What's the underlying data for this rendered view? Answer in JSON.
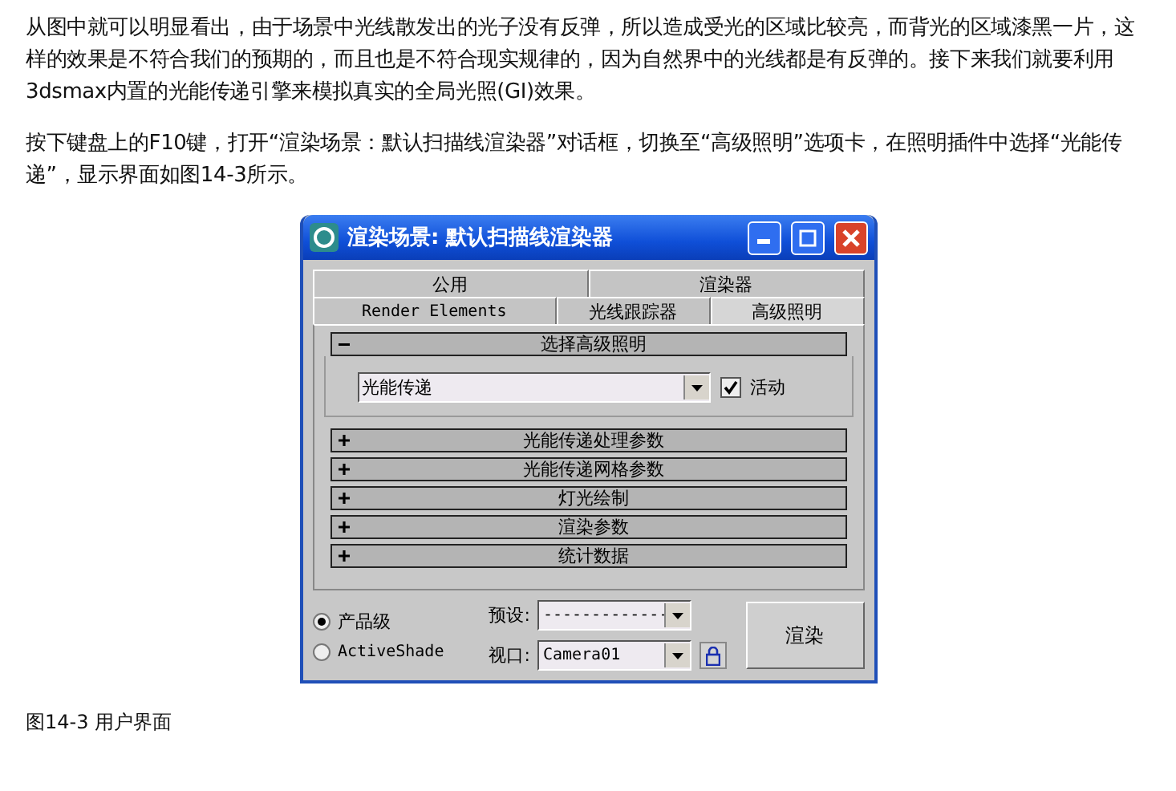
{
  "article": {
    "paragraphs": [
      "从图中就可以明显看出，由于场景中光线散发出的光子没有反弹，所以造成受光的区域比较亮，而背光的区域漆黑一片，这样的效果是不符合我们的预期的，而且也是不符合现实规律的，因为自然界中的光线都是有反弹的。接下来我们就要利用3dsmax内置的光能传递引擎来模拟真实的全局光照(GI)效果。",
      "按下键盘上的F10键，打开“渲染场景：默认扫描线渲染器”对话框，切换至“高级照明”选项卡，在照明插件中选择“光能传递”，显示界面如图14-3所示。"
    ]
  },
  "dialog": {
    "title": "渲染场景: 默认扫描线渲染器",
    "tab_rows": [
      [
        {
          "label": "公用",
          "selected": false
        },
        {
          "label": "渲染器",
          "selected": false
        }
      ],
      [
        {
          "label": "Render Elements",
          "selected": false
        },
        {
          "label": "光线跟踪器",
          "selected": false
        },
        {
          "label": "高级照明",
          "selected": true
        }
      ]
    ],
    "rollouts": [
      {
        "title": "选择高级照明",
        "expanded": true,
        "plugin": "光能传递",
        "active_label": "活动",
        "active": true
      },
      {
        "title": "光能传递处理参数",
        "expanded": false
      },
      {
        "title": "光能传递网格参数",
        "expanded": false
      },
      {
        "title": "灯光绘制",
        "expanded": false
      },
      {
        "title": "渲染参数",
        "expanded": false
      },
      {
        "title": "统计数据",
        "expanded": false
      }
    ],
    "modes": [
      {
        "label": "产品级",
        "selected": true
      },
      {
        "label": "ActiveShade",
        "selected": false
      }
    ],
    "preset": {
      "label": "预设:",
      "value": "-------------"
    },
    "viewport": {
      "label": "视口:",
      "value": "Camera01"
    },
    "render_button": "渲染"
  },
  "caption": "图14-3 用户界面"
}
